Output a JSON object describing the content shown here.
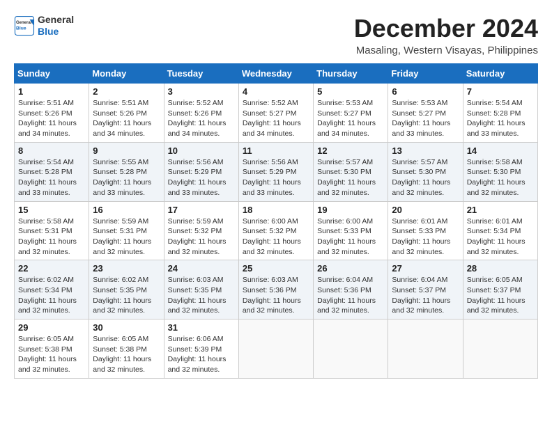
{
  "header": {
    "logo_general": "General",
    "logo_blue": "Blue",
    "main_title": "December 2024",
    "subtitle": "Masaling, Western Visayas, Philippines"
  },
  "calendar": {
    "columns": [
      "Sunday",
      "Monday",
      "Tuesday",
      "Wednesday",
      "Thursday",
      "Friday",
      "Saturday"
    ],
    "weeks": [
      [
        {
          "day": "",
          "detail": ""
        },
        {
          "day": "2",
          "detail": "Sunrise: 5:51 AM\nSunset: 5:26 PM\nDaylight: 11 hours\nand 34 minutes."
        },
        {
          "day": "3",
          "detail": "Sunrise: 5:52 AM\nSunset: 5:26 PM\nDaylight: 11 hours\nand 34 minutes."
        },
        {
          "day": "4",
          "detail": "Sunrise: 5:52 AM\nSunset: 5:27 PM\nDaylight: 11 hours\nand 34 minutes."
        },
        {
          "day": "5",
          "detail": "Sunrise: 5:53 AM\nSunset: 5:27 PM\nDaylight: 11 hours\nand 34 minutes."
        },
        {
          "day": "6",
          "detail": "Sunrise: 5:53 AM\nSunset: 5:27 PM\nDaylight: 11 hours\nand 33 minutes."
        },
        {
          "day": "7",
          "detail": "Sunrise: 5:54 AM\nSunset: 5:28 PM\nDaylight: 11 hours\nand 33 minutes."
        }
      ],
      [
        {
          "day": "1",
          "detail": "Sunrise: 5:51 AM\nSunset: 5:26 PM\nDaylight: 11 hours\nand 34 minutes."
        },
        {
          "day": "",
          "detail": ""
        },
        {
          "day": "",
          "detail": ""
        },
        {
          "day": "",
          "detail": ""
        },
        {
          "day": "",
          "detail": ""
        },
        {
          "day": "",
          "detail": ""
        },
        {
          "day": "",
          "detail": ""
        }
      ],
      [
        {
          "day": "8",
          "detail": "Sunrise: 5:54 AM\nSunset: 5:28 PM\nDaylight: 11 hours\nand 33 minutes."
        },
        {
          "day": "9",
          "detail": "Sunrise: 5:55 AM\nSunset: 5:28 PM\nDaylight: 11 hours\nand 33 minutes."
        },
        {
          "day": "10",
          "detail": "Sunrise: 5:56 AM\nSunset: 5:29 PM\nDaylight: 11 hours\nand 33 minutes."
        },
        {
          "day": "11",
          "detail": "Sunrise: 5:56 AM\nSunset: 5:29 PM\nDaylight: 11 hours\nand 33 minutes."
        },
        {
          "day": "12",
          "detail": "Sunrise: 5:57 AM\nSunset: 5:30 PM\nDaylight: 11 hours\nand 32 minutes."
        },
        {
          "day": "13",
          "detail": "Sunrise: 5:57 AM\nSunset: 5:30 PM\nDaylight: 11 hours\nand 32 minutes."
        },
        {
          "day": "14",
          "detail": "Sunrise: 5:58 AM\nSunset: 5:30 PM\nDaylight: 11 hours\nand 32 minutes."
        }
      ],
      [
        {
          "day": "15",
          "detail": "Sunrise: 5:58 AM\nSunset: 5:31 PM\nDaylight: 11 hours\nand 32 minutes."
        },
        {
          "day": "16",
          "detail": "Sunrise: 5:59 AM\nSunset: 5:31 PM\nDaylight: 11 hours\nand 32 minutes."
        },
        {
          "day": "17",
          "detail": "Sunrise: 5:59 AM\nSunset: 5:32 PM\nDaylight: 11 hours\nand 32 minutes."
        },
        {
          "day": "18",
          "detail": "Sunrise: 6:00 AM\nSunset: 5:32 PM\nDaylight: 11 hours\nand 32 minutes."
        },
        {
          "day": "19",
          "detail": "Sunrise: 6:00 AM\nSunset: 5:33 PM\nDaylight: 11 hours\nand 32 minutes."
        },
        {
          "day": "20",
          "detail": "Sunrise: 6:01 AM\nSunset: 5:33 PM\nDaylight: 11 hours\nand 32 minutes."
        },
        {
          "day": "21",
          "detail": "Sunrise: 6:01 AM\nSunset: 5:34 PM\nDaylight: 11 hours\nand 32 minutes."
        }
      ],
      [
        {
          "day": "22",
          "detail": "Sunrise: 6:02 AM\nSunset: 5:34 PM\nDaylight: 11 hours\nand 32 minutes."
        },
        {
          "day": "23",
          "detail": "Sunrise: 6:02 AM\nSunset: 5:35 PM\nDaylight: 11 hours\nand 32 minutes."
        },
        {
          "day": "24",
          "detail": "Sunrise: 6:03 AM\nSunset: 5:35 PM\nDaylight: 11 hours\nand 32 minutes."
        },
        {
          "day": "25",
          "detail": "Sunrise: 6:03 AM\nSunset: 5:36 PM\nDaylight: 11 hours\nand 32 minutes."
        },
        {
          "day": "26",
          "detail": "Sunrise: 6:04 AM\nSunset: 5:36 PM\nDaylight: 11 hours\nand 32 minutes."
        },
        {
          "day": "27",
          "detail": "Sunrise: 6:04 AM\nSunset: 5:37 PM\nDaylight: 11 hours\nand 32 minutes."
        },
        {
          "day": "28",
          "detail": "Sunrise: 6:05 AM\nSunset: 5:37 PM\nDaylight: 11 hours\nand 32 minutes."
        }
      ],
      [
        {
          "day": "29",
          "detail": "Sunrise: 6:05 AM\nSunset: 5:38 PM\nDaylight: 11 hours\nand 32 minutes."
        },
        {
          "day": "30",
          "detail": "Sunrise: 6:05 AM\nSunset: 5:38 PM\nDaylight: 11 hours\nand 32 minutes."
        },
        {
          "day": "31",
          "detail": "Sunrise: 6:06 AM\nSunset: 5:39 PM\nDaylight: 11 hours\nand 32 minutes."
        },
        {
          "day": "",
          "detail": ""
        },
        {
          "day": "",
          "detail": ""
        },
        {
          "day": "",
          "detail": ""
        },
        {
          "day": "",
          "detail": ""
        }
      ]
    ]
  }
}
